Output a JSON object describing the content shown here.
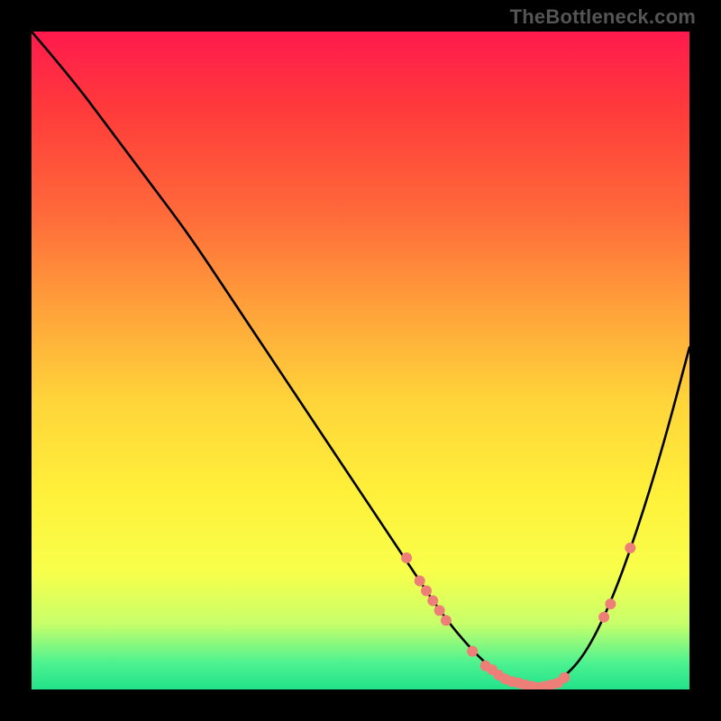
{
  "attribution": "TheBottleneck.com",
  "colors": {
    "background": "#000000",
    "attribution_text": "#555555",
    "curve_stroke": "#000000",
    "marker_fill": "#ed7f78",
    "gradient_top": "#ff1a4d",
    "gradient_bottom": "#22e28a"
  },
  "chart_data": {
    "type": "line",
    "title": "",
    "xlabel": "",
    "ylabel": "",
    "xlim": [
      0,
      100
    ],
    "ylim": [
      0,
      100
    ],
    "x": [
      0,
      6,
      12,
      18,
      24,
      30,
      36,
      42,
      48,
      54,
      58,
      62,
      66,
      70,
      74,
      77,
      80,
      84,
      88,
      92,
      96,
      100
    ],
    "y": [
      100,
      93,
      85,
      77,
      69,
      60,
      51,
      42,
      33,
      24,
      18,
      12,
      7,
      3,
      1,
      0.3,
      1,
      5,
      13,
      24,
      37,
      52
    ],
    "series": [
      {
        "name": "bottleneck-curve",
        "kind": "line",
        "x": [
          0,
          6,
          12,
          18,
          24,
          30,
          36,
          42,
          48,
          54,
          58,
          62,
          66,
          70,
          74,
          77,
          80,
          84,
          88,
          92,
          96,
          100
        ],
        "y": [
          100,
          93,
          85,
          77,
          69,
          60,
          51,
          42,
          33,
          24,
          18,
          12,
          7,
          3,
          1,
          0.3,
          1,
          5,
          13,
          24,
          37,
          52
        ]
      },
      {
        "name": "highlight-points",
        "kind": "scatter",
        "x": [
          57,
          59,
          60,
          61,
          62,
          63,
          67,
          69,
          70,
          71,
          72,
          73,
          74,
          75,
          76,
          77,
          78,
          79,
          80,
          81,
          87,
          88,
          91
        ],
        "y": [
          20,
          16.5,
          15,
          13.5,
          12,
          10.5,
          5.8,
          3.6,
          3.0,
          2.2,
          1.6,
          1.2,
          1.0,
          0.7,
          0.5,
          0.3,
          0.5,
          0.7,
          1.0,
          1.8,
          11.0,
          13.0,
          21.5
        ]
      }
    ]
  }
}
